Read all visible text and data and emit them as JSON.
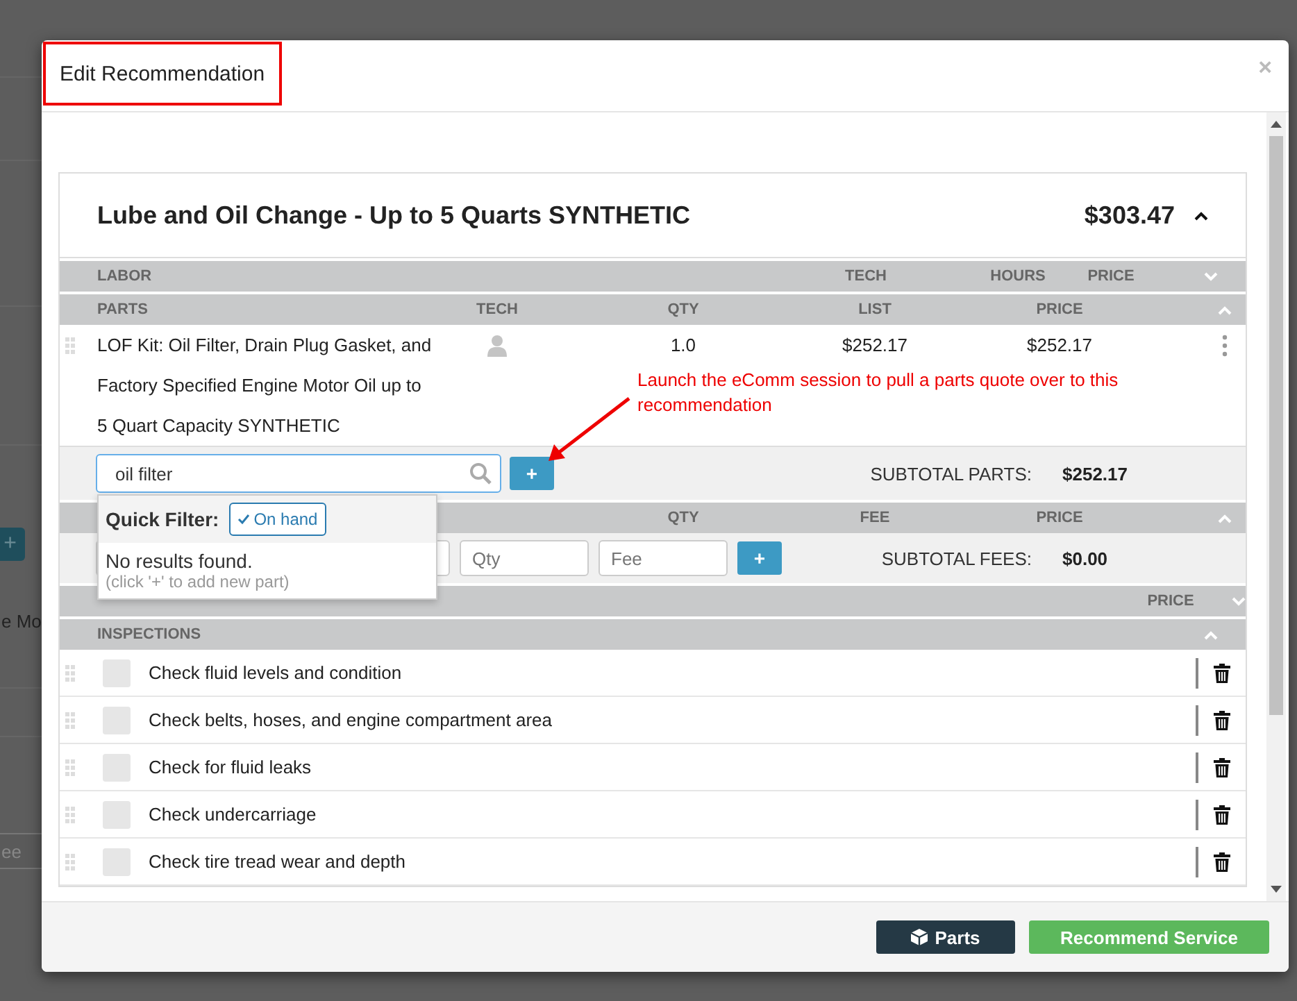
{
  "background": {
    "add_label": "+",
    "row_text": "e Mo",
    "field_text": "ee"
  },
  "window": {
    "title": "Edit Recommendation",
    "close": "×"
  },
  "service": {
    "title": "Lube and Oil Change - Up to 5 Quarts SYNTHETIC",
    "price": "$303.47",
    "expanded": true
  },
  "sections": [
    {
      "kind": "labor",
      "title": "LABOR",
      "columns": [
        "TECH",
        "HOURS",
        "PRICE"
      ],
      "expanded": false
    },
    {
      "kind": "parts",
      "title": "PARTS",
      "columns": [
        "TECH",
        "QTY",
        "LIST",
        "PRICE"
      ],
      "expanded": true,
      "rows": [
        {
          "name": "LOF Kit: Oil Filter, Drain Plug Gasket, and Factory Specified Engine Motor Oil up to 5 Quart Capacity SYNTHETIC",
          "qty": "1.0",
          "list": "$252.17",
          "price": "$252.17"
        }
      ],
      "search": {
        "value": "oil filter",
        "add_label": "+"
      },
      "dropdown": {
        "filter_label": "Quick Filter:",
        "filter_chip": "On hand",
        "filter_checked": true,
        "message": "No results found.",
        "hint": "(click '+' to add new part)"
      },
      "subtotal_label": "SUBTOTAL PARTS:",
      "subtotal": "$252.17"
    },
    {
      "kind": "fees",
      "columns": [
        "QTY",
        "FEE",
        "PRICE"
      ],
      "expanded": true,
      "inputs": [
        {
          "placeholder": "Qty"
        },
        {
          "placeholder": "Fee"
        }
      ],
      "add_label": "+",
      "subtotal_label": "SUBTOTAL FEES:",
      "subtotal": "$0.00"
    },
    {
      "kind": "sublet",
      "columns": [
        "PRICE"
      ],
      "expanded": false
    },
    {
      "kind": "inspections",
      "title": "INSPECTIONS",
      "expanded": true,
      "items": [
        {
          "text": "Check fluid levels and condition",
          "checked": false
        },
        {
          "text": "Check belts, hoses, and engine compartment area",
          "checked": false
        },
        {
          "text": "Check for fluid leaks",
          "checked": false
        },
        {
          "text": "Check undercarriage",
          "checked": false
        },
        {
          "text": "Check tire tread wear and depth",
          "checked": false
        }
      ]
    }
  ],
  "annotation": {
    "text": "Launch the eComm session to pull a parts quote over to this recommendation"
  },
  "footer": {
    "buttons": [
      {
        "kind": "secondary",
        "label": "Parts"
      },
      {
        "kind": "primary",
        "label": "Recommend Service"
      }
    ]
  }
}
